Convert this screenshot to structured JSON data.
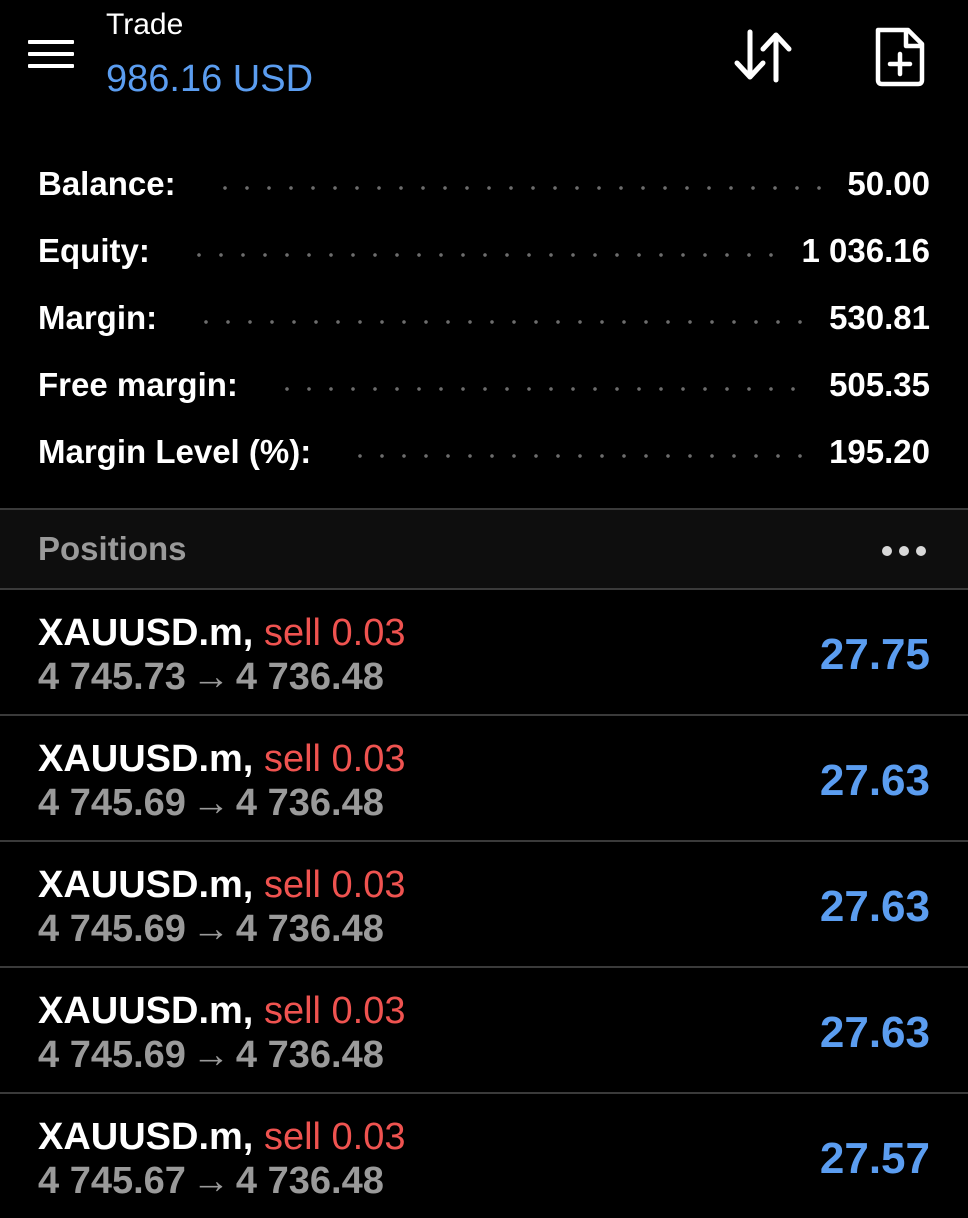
{
  "header": {
    "title": "Trade",
    "balance": "986.16 USD",
    "icons": {
      "menu": "hamburger-menu-icon",
      "sort": "sort-arrows-icon",
      "new_order": "document-plus-icon"
    }
  },
  "account": [
    {
      "label": "Balance:",
      "value": "50.00"
    },
    {
      "label": "Equity:",
      "value": "1 036.16"
    },
    {
      "label": "Margin:",
      "value": "530.81"
    },
    {
      "label": "Free margin:",
      "value": "505.35"
    },
    {
      "label": "Margin Level (%):",
      "value": "195.20"
    }
  ],
  "positions": {
    "title": "Positions",
    "more_icon": "more-dots-icon",
    "items": [
      {
        "symbol": "XAUUSD.m,",
        "side": "sell 0.03",
        "open_price": "4 745.73",
        "arrow": "→",
        "current_price": "4 736.48",
        "profit": "27.75"
      },
      {
        "symbol": "XAUUSD.m,",
        "side": "sell 0.03",
        "open_price": "4 745.69",
        "arrow": "→",
        "current_price": "4 736.48",
        "profit": "27.63"
      },
      {
        "symbol": "XAUUSD.m,",
        "side": "sell 0.03",
        "open_price": "4 745.69",
        "arrow": "→",
        "current_price": "4 736.48",
        "profit": "27.63"
      },
      {
        "symbol": "XAUUSD.m,",
        "side": "sell 0.03",
        "open_price": "4 745.69",
        "arrow": "→",
        "current_price": "4 736.48",
        "profit": "27.63"
      },
      {
        "symbol": "XAUUSD.m,",
        "side": "sell 0.03",
        "open_price": "4 745.67",
        "arrow": "→",
        "current_price": "4 736.48",
        "profit": "27.57"
      }
    ]
  },
  "colors": {
    "background": "#000000",
    "accent_blue": "#5b9df0",
    "sell_red": "#ef5350",
    "muted_gray": "#9a9a9a",
    "divider": "#3a3a3a"
  }
}
